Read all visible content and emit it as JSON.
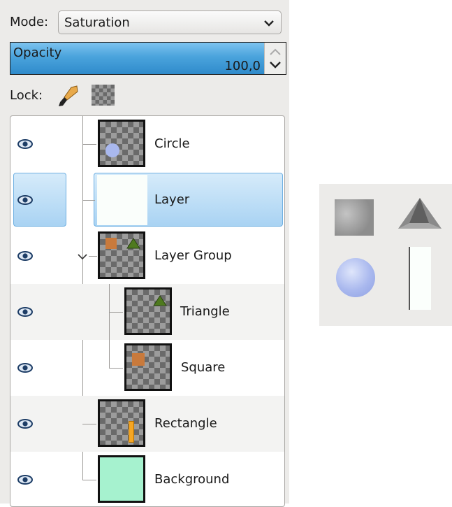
{
  "mode": {
    "label": "Mode:",
    "value": "Saturation"
  },
  "opacity": {
    "label": "Opacity",
    "value": "100,0",
    "fraction": 1.0
  },
  "lock": {
    "label": "Lock:"
  },
  "layers": [
    {
      "name": "Circle",
      "visible": true,
      "selected": false,
      "depth": 0
    },
    {
      "name": "Layer",
      "visible": true,
      "selected": true,
      "depth": 0
    },
    {
      "name": "Layer Group",
      "visible": true,
      "selected": false,
      "depth": 0,
      "expanded": true
    },
    {
      "name": "Triangle",
      "visible": true,
      "selected": false,
      "depth": 1
    },
    {
      "name": "Square",
      "visible": true,
      "selected": false,
      "depth": 1
    },
    {
      "name": "Rectangle",
      "visible": true,
      "selected": false,
      "depth": 0
    },
    {
      "name": "Background",
      "visible": true,
      "selected": false,
      "depth": 0
    }
  ],
  "colors": {
    "selection": "#a9d3f3",
    "background_layer": "#a6f2cf",
    "rectangle": "#f5a623",
    "circle": "#a9b8ee"
  }
}
